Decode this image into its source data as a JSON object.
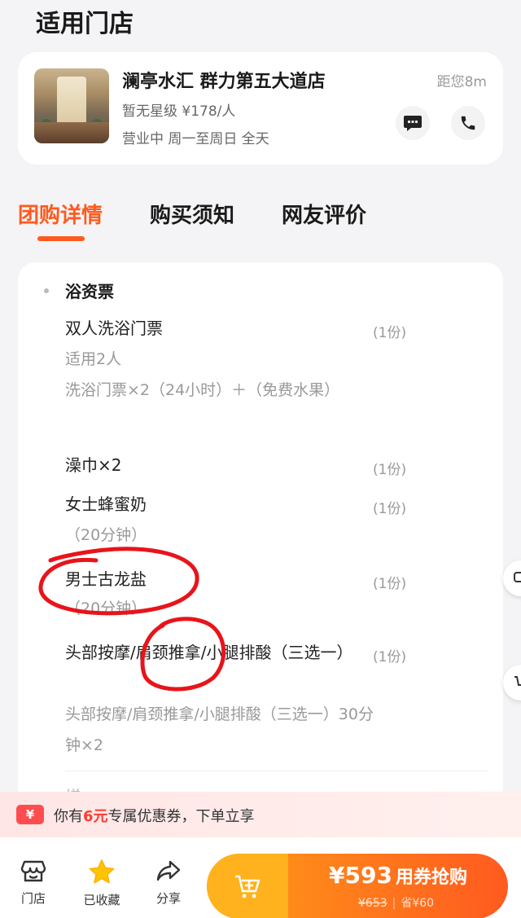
{
  "section": {
    "title": "适用门店"
  },
  "store": {
    "name": "澜亭水汇 群力第五大道店",
    "distance": "距您8m",
    "rating_line": "暂无星级  ¥178/人",
    "hours_line": "营业中  周一至周日 全天",
    "message_icon": "message-icon",
    "phone_icon": "phone-icon"
  },
  "tabs": [
    {
      "label": "团购详情",
      "active": true
    },
    {
      "label": "购买须知",
      "active": false
    },
    {
      "label": "网友评价",
      "active": false
    }
  ],
  "deal": {
    "category": "浴资票",
    "items": [
      {
        "name": "双人洗浴门票",
        "qty": "(1份)",
        "sub1": "适用2人",
        "sub2": "洗浴门票×2（24小时）＋（免费水果）"
      },
      {
        "name": "澡巾×2",
        "qty": "(1份)"
      },
      {
        "name": "女士蜂蜜奶",
        "qty": "(1份)",
        "sub1": "（20分钟）"
      },
      {
        "name": "男士古龙盐",
        "qty": "(1份)",
        "sub1": "（20分钟）"
      },
      {
        "name": "头部按摩/肩颈推拿/小腿排酸（三选一）",
        "qty": "(1份)",
        "sub1": "头部按摩/肩颈推拿/小腿排酸（三选一）30分钟×2"
      }
    ],
    "cut_text": "增...",
    "annotation_color": "#e8141b"
  },
  "coupon": {
    "icon_text": "¥",
    "prefix": "你有",
    "amount": "6元",
    "suffix": "专属优惠券，下单立享"
  },
  "bottom_nav": [
    {
      "label": "门店",
      "icon": "store-icon"
    },
    {
      "label": "已收藏",
      "icon": "star-icon"
    },
    {
      "label": "分享",
      "icon": "share-icon"
    }
  ],
  "buy": {
    "price": "¥593",
    "cta": "用券抢购",
    "original": "¥653",
    "save": "省¥60",
    "accent_start": "#ffb21d",
    "accent_end": "#ff5a1f"
  }
}
